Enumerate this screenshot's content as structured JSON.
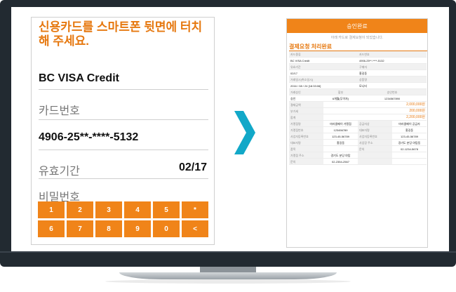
{
  "left": {
    "prompt": "신용카드를 스마트폰 뒷면에 터치해 주세요.",
    "card_type": "BC VISA Credit",
    "card_number_label": "카드번호",
    "card_number": "4906-25**-****-5132",
    "expiry_label": "유효기간",
    "expiry_value": "02/17",
    "password_label": "비밀번호",
    "keys": [
      "1",
      "2",
      "3",
      "4",
      "5",
      "*",
      "6",
      "7",
      "8",
      "9",
      "0",
      "<"
    ]
  },
  "right": {
    "header": "승인완료",
    "subtitle": "아래 카드로 결제요청이 되었습니다.",
    "section_title": "결제요청 처리완료",
    "rows": [
      {
        "type": "pair",
        "l1": "카드종류",
        "l2": "카드번호"
      },
      {
        "type": "pair",
        "l1": "BC VISA Credit",
        "l2": "4906-25**-****-5132"
      },
      {
        "type": "pair",
        "l1": "유효기간",
        "l2": "구매자"
      },
      {
        "type": "pair",
        "l1": "02/17",
        "l2": "홍길동"
      },
      {
        "type": "pair",
        "l1": "거래일시(취소일시)",
        "l2": "상품명"
      },
      {
        "type": "pair",
        "l1": "2016 / 08 / 24 [18:33:06]",
        "l2": "모니터"
      },
      {
        "type": "head",
        "a": "거래승인",
        "b": "할부",
        "c": "승인번호"
      },
      {
        "type": "three",
        "a": "승인",
        "b": "6개월(무이자)",
        "c": "1234567890"
      },
      {
        "type": "amount",
        "label": "결제금액",
        "value": "2,000,000원"
      },
      {
        "type": "amount",
        "label": "부가세",
        "value": "200,000원"
      },
      {
        "type": "amount",
        "label": "합계",
        "value": "2,200,000원"
      },
      {
        "type": "four",
        "a": "가맹점명",
        "b": "마라클페이 가맹점",
        "c": "공급자상",
        "d": "마라클페이 공급자"
      },
      {
        "type": "four",
        "a": "가맹점번호",
        "b": "123456789",
        "c": "대표자명",
        "d": "홍길동"
      },
      {
        "type": "four",
        "a": "사업자등록번호",
        "b": "123-45-56789",
        "c": "사업자등록번호",
        "d": "123-45-56789"
      },
      {
        "type": "four",
        "a": "대표자명",
        "b": "홍길동",
        "c": "사업장 주소",
        "d": "경기도 분당 야탑동"
      },
      {
        "type": "four",
        "a": "품목",
        "b": "",
        "c": "문의",
        "d": "02-1234-5678"
      },
      {
        "type": "four",
        "a": "가맹점 주소",
        "b": "경기도 분당 야탑",
        "c": "",
        "d": ""
      },
      {
        "type": "four",
        "a": "문의",
        "b": "02-2354-2567",
        "c": "",
        "d": ""
      }
    ]
  },
  "colors": {
    "accent": "#f08419",
    "arrow": "#12a8c8",
    "monitor": "#222a31"
  }
}
